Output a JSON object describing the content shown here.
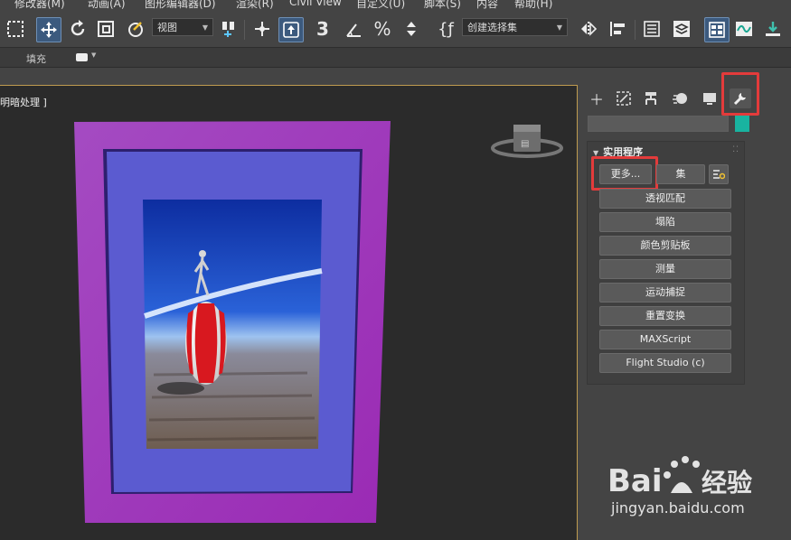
{
  "menu": {
    "items": [
      "修改器(M)",
      "动画(A)",
      "图形编辑器(D)",
      "渲染(R)",
      "Civil View",
      "自定义(U)",
      "脚本(S)",
      "内容",
      "帮助(H)"
    ]
  },
  "toolbar": {
    "view_dropdown": "视图",
    "selection_set_dropdown": "创建选择集",
    "icons": [
      "select-region-icon",
      "move-icon",
      "rotate-icon",
      "scale-icon",
      "select-link-icon",
      "pivot-icon",
      "snap-icon",
      "angle-snap-icon",
      "percent-snap-icon",
      "spinner-snap-icon",
      "selection-set-icon",
      "mirror-icon",
      "align-icon",
      "scene-explorer-icon",
      "layer-icon",
      "ribbon-icon",
      "curve-editor-icon",
      "render-setup-icon"
    ]
  },
  "ribbon": {
    "fill_label": "填充"
  },
  "viewport": {
    "label": "明暗处理 ]"
  },
  "command_panel": {
    "tabs": [
      "create",
      "modify",
      "hierarchy",
      "motion",
      "display",
      "utilities"
    ],
    "accent_color": "#19b3a0",
    "rollout_title": "实用程序",
    "more_button": "更多...",
    "sets_button": "集",
    "utilities": [
      "透视匹配",
      "塌陷",
      "颜色剪贴板",
      "测量",
      "运动捕捉",
      "重置变换",
      "MAXScript",
      "Flight Studio (c)"
    ]
  },
  "watermark": {
    "url": "jingyan.baidu.com"
  }
}
